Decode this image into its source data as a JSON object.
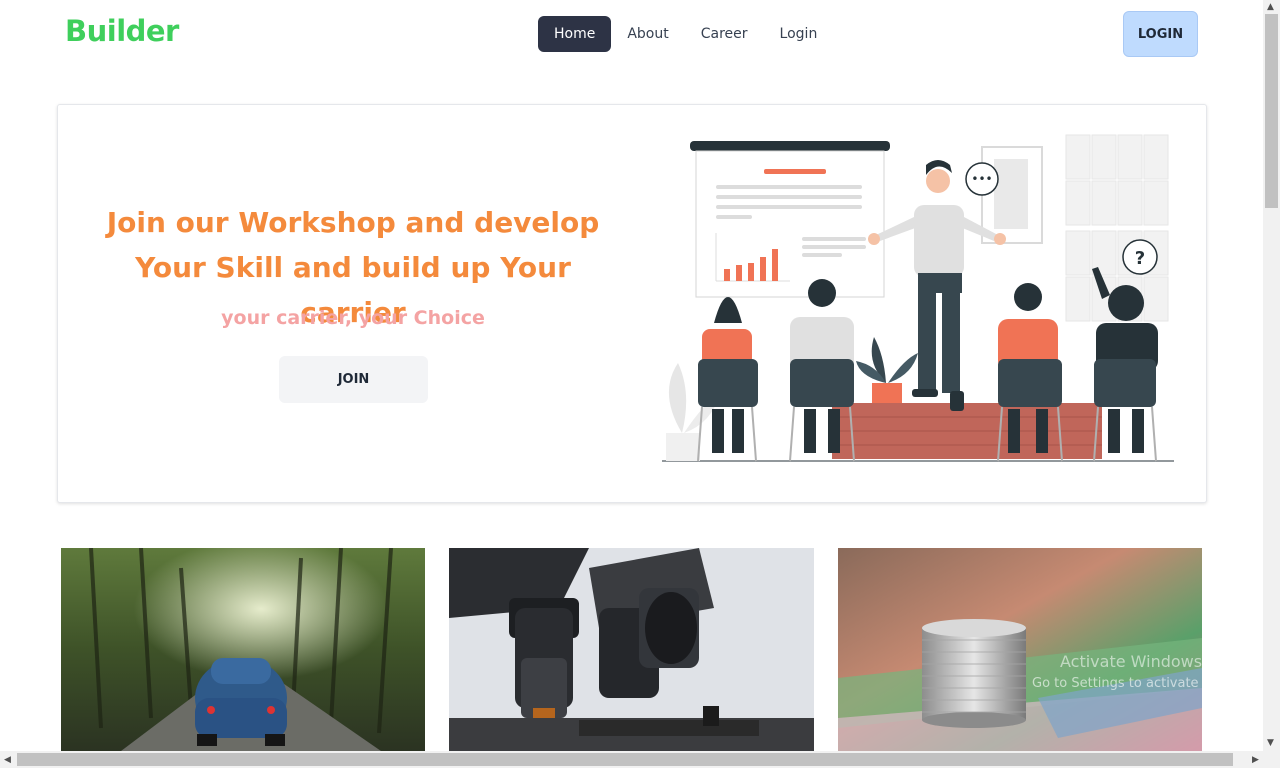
{
  "brand": {
    "name": "Builder",
    "color": "#3fcf5c"
  },
  "nav": {
    "items": [
      {
        "label": "Home",
        "active": true
      },
      {
        "label": "About",
        "active": false
      },
      {
        "label": "Career",
        "active": false
      },
      {
        "label": "Login",
        "active": false
      }
    ],
    "login_button": "LOGIN"
  },
  "hero": {
    "title_line1": "Join our Workshop and develop",
    "title_line2": "Your Skill and build up Your carrier",
    "subtitle": "your carrier, your Choice",
    "join_button": "JOIN",
    "illustration": "workshop-presentation-illustration",
    "title_color": "#f48a3c",
    "subtitle_color": "#f4a3a3",
    "speech_bubble_dots": "•••",
    "question_mark": "?"
  },
  "cards": [
    {
      "image": "blue-vintage-car-forest-road"
    },
    {
      "image": "microscope-closeup"
    },
    {
      "image": "coin-stack-on-banknotes"
    }
  ],
  "watermark": {
    "line1": "Activate Windows",
    "line2": "Go to Settings to activate Windows."
  }
}
